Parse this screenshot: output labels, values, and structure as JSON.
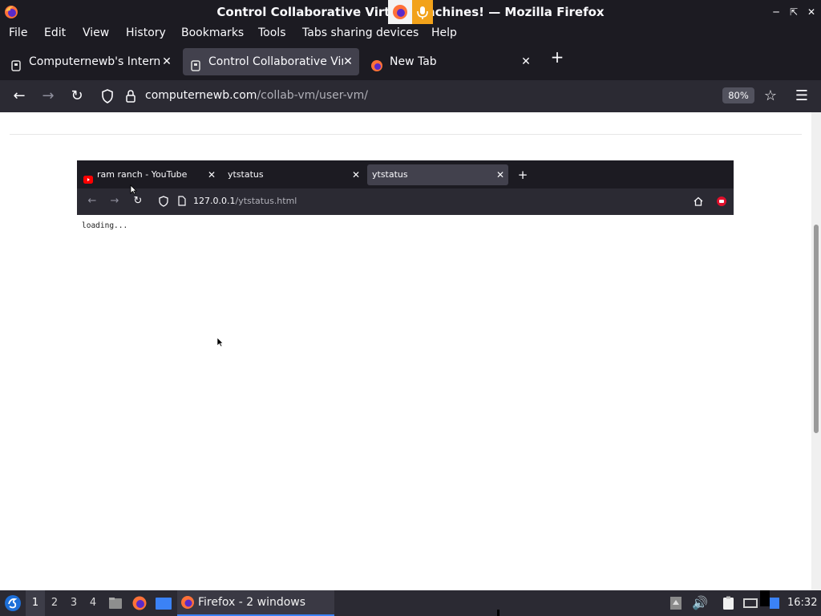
{
  "window": {
    "title": "Control Collaborative Virtual Machines! — Mozilla Firefox"
  },
  "menubar": {
    "items": [
      "File",
      "Edit",
      "View",
      "History",
      "Bookmarks",
      "Tools",
      "Tabs sharing devices",
      "Help"
    ]
  },
  "tabs": [
    {
      "label": "Computernewb's Internet",
      "active": false,
      "icon": "site-icon"
    },
    {
      "label": "Control Collaborative Virtual Machines!",
      "active": true,
      "icon": "site-icon"
    },
    {
      "label": "New Tab",
      "active": false,
      "icon": "firefox-icon"
    }
  ],
  "navbar": {
    "url_domain": "computernewb.com",
    "url_path": "/collab-vm/user-vm/",
    "zoom": "80%"
  },
  "vm": {
    "tabs": [
      {
        "label": "ram ranch - YouTube",
        "active": false,
        "icon": "youtube-icon"
      },
      {
        "label": "ytstatus",
        "active": false
      },
      {
        "label": "ytstatus",
        "active": true
      }
    ],
    "url_domain": "127.0.0.1",
    "url_path": "/ytstatus.html",
    "content_text": "loading..."
  },
  "taskbar": {
    "workspaces": [
      "1",
      "2",
      "3",
      "4"
    ],
    "active_workspace": "1",
    "task_label": "Firefox - 2 windows",
    "clock": "16:32"
  },
  "colors": {
    "chrome_dark": "#1c1b22",
    "toolbar": "#2b2a33",
    "active_tab": "#42414d",
    "accent": "#3b82f6"
  }
}
